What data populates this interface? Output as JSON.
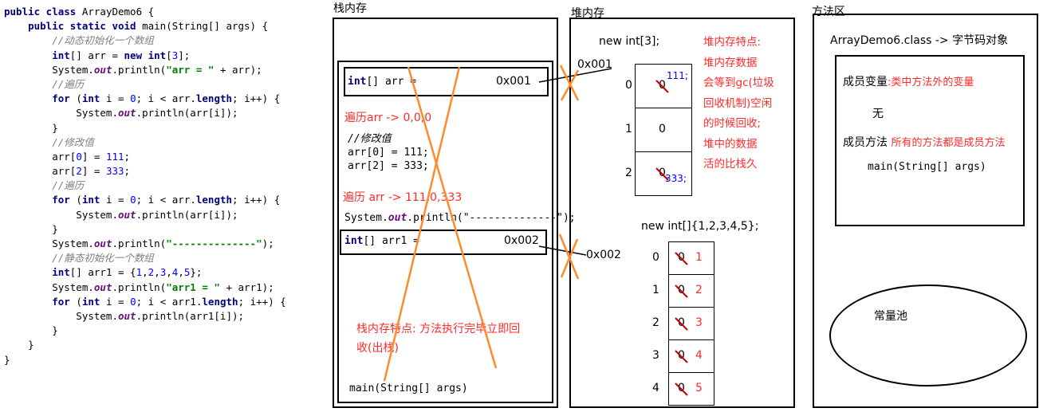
{
  "code": {
    "lines": [
      [
        {
          "t": "public class ",
          "c": "kw"
        },
        {
          "t": "ArrayDemo6 {",
          "c": ""
        }
      ],
      [
        {
          "t": "    public static void ",
          "c": "kw"
        },
        {
          "t": "main(String[] args) {",
          "c": ""
        }
      ],
      [
        {
          "t": "        //动态初始化一个数组",
          "c": "cm"
        }
      ],
      [
        {
          "t": "        ",
          "c": ""
        },
        {
          "t": "int",
          "c": "kw"
        },
        {
          "t": "[] arr = ",
          "c": ""
        },
        {
          "t": "new int",
          "c": "kw"
        },
        {
          "t": "[",
          "c": ""
        },
        {
          "t": "3",
          "c": "num"
        },
        {
          "t": "];",
          "c": ""
        }
      ],
      [
        {
          "t": "        System.",
          "c": ""
        },
        {
          "t": "out",
          "c": "fld"
        },
        {
          "t": ".println(",
          "c": ""
        },
        {
          "t": "\"arr = \"",
          "c": "str"
        },
        {
          "t": " + arr);",
          "c": ""
        }
      ],
      [
        {
          "t": "        //遍历",
          "c": "cm"
        }
      ],
      [
        {
          "t": "        ",
          "c": ""
        },
        {
          "t": "for",
          "c": "kw"
        },
        {
          "t": " (",
          "c": ""
        },
        {
          "t": "int",
          "c": "kw"
        },
        {
          "t": " i = ",
          "c": ""
        },
        {
          "t": "0",
          "c": "num"
        },
        {
          "t": "; i < arr.",
          "c": ""
        },
        {
          "t": "length",
          "c": "kw"
        },
        {
          "t": "; i++) {",
          "c": ""
        }
      ],
      [
        {
          "t": "            System.",
          "c": ""
        },
        {
          "t": "out",
          "c": "fld"
        },
        {
          "t": ".println(arr[i]);",
          "c": ""
        }
      ],
      [
        {
          "t": "        }",
          "c": ""
        }
      ],
      [
        {
          "t": "        //修改值",
          "c": "cm"
        }
      ],
      [
        {
          "t": "        arr[",
          "c": ""
        },
        {
          "t": "0",
          "c": "num"
        },
        {
          "t": "] = ",
          "c": ""
        },
        {
          "t": "111",
          "c": "num"
        },
        {
          "t": ";",
          "c": ""
        }
      ],
      [
        {
          "t": "        arr[",
          "c": ""
        },
        {
          "t": "2",
          "c": "num"
        },
        {
          "t": "] = ",
          "c": ""
        },
        {
          "t": "333",
          "c": "num"
        },
        {
          "t": ";",
          "c": ""
        }
      ],
      [
        {
          "t": "        //遍历",
          "c": "cm"
        }
      ],
      [
        {
          "t": "        ",
          "c": ""
        },
        {
          "t": "for",
          "c": "kw"
        },
        {
          "t": " (",
          "c": ""
        },
        {
          "t": "int",
          "c": "kw"
        },
        {
          "t": " i = ",
          "c": ""
        },
        {
          "t": "0",
          "c": "num"
        },
        {
          "t": "; i < arr.",
          "c": ""
        },
        {
          "t": "length",
          "c": "kw"
        },
        {
          "t": "; i++) {",
          "c": ""
        }
      ],
      [
        {
          "t": "            System.",
          "c": ""
        },
        {
          "t": "out",
          "c": "fld"
        },
        {
          "t": ".println(arr[i]);",
          "c": ""
        }
      ],
      [
        {
          "t": "        }",
          "c": ""
        }
      ],
      [
        {
          "t": "        System.",
          "c": ""
        },
        {
          "t": "out",
          "c": "fld"
        },
        {
          "t": ".println(",
          "c": ""
        },
        {
          "t": "\"--------------\"",
          "c": "str"
        },
        {
          "t": ");",
          "c": ""
        }
      ],
      [
        {
          "t": "        //静态初始化一个数组",
          "c": "cm"
        }
      ],
      [
        {
          "t": "        ",
          "c": ""
        },
        {
          "t": "int",
          "c": "kw"
        },
        {
          "t": "[] arr1 = {",
          "c": ""
        },
        {
          "t": "1",
          "c": "num"
        },
        {
          "t": ",",
          "c": ""
        },
        {
          "t": "2",
          "c": "num"
        },
        {
          "t": ",",
          "c": ""
        },
        {
          "t": "3",
          "c": "num"
        },
        {
          "t": ",",
          "c": ""
        },
        {
          "t": "4",
          "c": "num"
        },
        {
          "t": ",",
          "c": ""
        },
        {
          "t": "5",
          "c": "num"
        },
        {
          "t": "};",
          "c": ""
        }
      ],
      [
        {
          "t": "        System.",
          "c": ""
        },
        {
          "t": "out",
          "c": "fld"
        },
        {
          "t": ".println(",
          "c": ""
        },
        {
          "t": "\"arr1 = \"",
          "c": "str"
        },
        {
          "t": " + arr1);",
          "c": ""
        }
      ],
      [
        {
          "t": "        ",
          "c": ""
        },
        {
          "t": "for",
          "c": "kw"
        },
        {
          "t": " (",
          "c": ""
        },
        {
          "t": "int",
          "c": "kw"
        },
        {
          "t": " i = ",
          "c": ""
        },
        {
          "t": "0",
          "c": "num"
        },
        {
          "t": "; i < arr1.",
          "c": ""
        },
        {
          "t": "length",
          "c": "kw"
        },
        {
          "t": "; i++) {",
          "c": ""
        }
      ],
      [
        {
          "t": "            System.",
          "c": ""
        },
        {
          "t": "out",
          "c": "fld"
        },
        {
          "t": ".println(arr1[i]);",
          "c": ""
        }
      ],
      [
        {
          "t": "        }",
          "c": ""
        }
      ],
      [
        {
          "t": "    }",
          "c": ""
        }
      ],
      [
        {
          "t": "}",
          "c": ""
        }
      ]
    ]
  },
  "stack": {
    "title": "栈内存",
    "arr_type": "int",
    "arr_decl": "[] arr =",
    "arr_addr": "0x001",
    "traverse1": "遍历arr -> 0,0,0",
    "modify_comment": "//修改值",
    "modify_line1": "arr[0] = 111;",
    "modify_line2": "arr[2] = 333;",
    "traverse2": "遍历 arr -> 111,0,333",
    "print_pre": "System.",
    "print_out": "out",
    "print_post": ".println(\"--------------\");",
    "arr1_type": "int",
    "arr1_decl": "[] arr1 =",
    "arr1_addr": "0x002",
    "feature_line1": "栈内存特点: 方法执行完毕立即回",
    "feature_line2": "收(出栈)",
    "main_frame": "main(String[] args)"
  },
  "heap": {
    "title": "堆内存",
    "new1": "new int[3];",
    "addr1": "0x001",
    "array1": [
      {
        "index": "0",
        "old": "0",
        "new": "111;"
      },
      {
        "index": "1",
        "old": "0",
        "new": ""
      },
      {
        "index": "2",
        "old": "0",
        "new": "333;"
      }
    ],
    "feature_lines": [
      "堆内存特点:",
      "堆内存数据",
      "会等到gc(垃圾",
      "回收机制)空闲",
      "的时候回收;",
      "堆中的数据",
      "活的比栈久"
    ],
    "new2": "new int[]{1,2,3,4,5};",
    "addr2": "0x002",
    "array2": [
      {
        "index": "0",
        "old": "0",
        "new": "1"
      },
      {
        "index": "1",
        "old": "0",
        "new": "2"
      },
      {
        "index": "2",
        "old": "0",
        "new": "3"
      },
      {
        "index": "3",
        "old": "0",
        "new": "4"
      },
      {
        "index": "4",
        "old": "0",
        "new": "5"
      }
    ]
  },
  "method": {
    "title": "方法区",
    "class_label": "ArrayDemo6.class -> 字节码对象",
    "member_var": "成员变量",
    "member_var_note": ":类中方法外的变量",
    "none": "无",
    "member_method": "成员方法",
    "member_method_note": "所有的方法都是成员方法",
    "main_sig": "main(String[] args)",
    "const_pool": "常量池"
  },
  "colors": {
    "orange": "#ff8a2a",
    "red": "#ff2a2a",
    "keyword": "#000080",
    "comment": "#808080",
    "number": "#0000ff",
    "string": "#008000"
  }
}
